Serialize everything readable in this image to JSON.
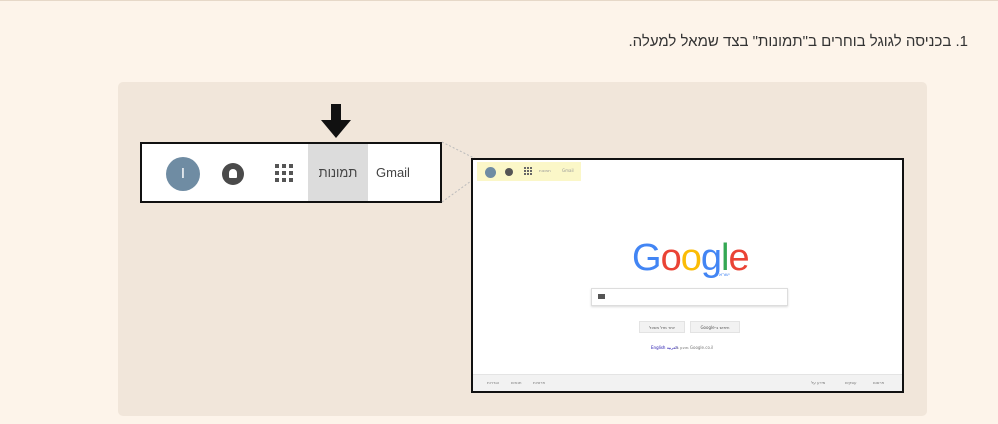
{
  "instruction": "1. בכניסה לגוגל בוחרים ב\"תמונות\" בצד שמאל למעלה.",
  "colors": {
    "page_background": "#fdf4ea",
    "panel_background": "#f1e6da",
    "highlight": "#fbf7c8",
    "avatar": "#6f8ca3",
    "images_tab": "#dcdcdc"
  },
  "zoomed_bar": {
    "avatar_letter": "I",
    "images_tab": "תמונות",
    "gmail": "Gmail",
    "icons": [
      "avatar",
      "notifications-icon",
      "apps-grid-icon"
    ]
  },
  "browser": {
    "top_bar": {
      "images": "תמונות",
      "gmail": "Gmail"
    },
    "logo_letters": [
      "G",
      "o",
      "o",
      "g",
      "l",
      "e"
    ],
    "logo_sub": "ישראל",
    "search_button": "חיפוש ב-Google",
    "lucky_button": "יותר מזל משכל",
    "offered_in_text": "Google.co.il מוצע ב:",
    "offered_in_langs": "English  العربية",
    "footer_left": [
      "הגדרות",
      "תנאים",
      "פרטיות"
    ],
    "footer_right": [
      "פרסום",
      "עסקים",
      "מידע על"
    ]
  }
}
